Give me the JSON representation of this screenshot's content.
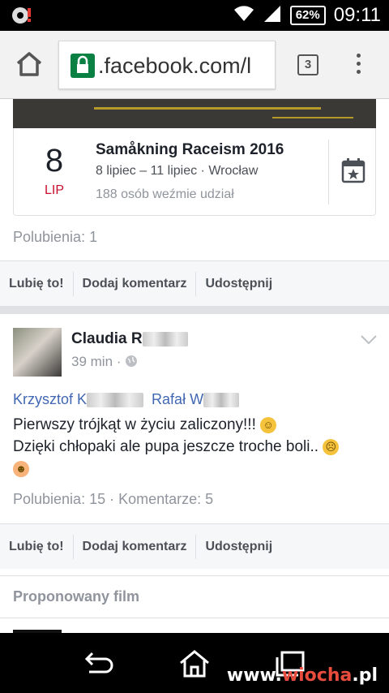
{
  "status_bar": {
    "battery": "62%",
    "time": "09:11",
    "icons": [
      "notification-icon",
      "wifi-icon",
      "signal-icon",
      "battery-icon"
    ]
  },
  "browser": {
    "url": ".facebook.com/l",
    "tab_count": "3"
  },
  "event": {
    "day": "8",
    "month": "LIP",
    "title": "Samåkning Raceism 2016",
    "details": "8 lipiec – 11 lipiec · Wrocław",
    "going": "188 osób weźmie udział"
  },
  "event_post": {
    "likes": "Polubienia: 1"
  },
  "actions": {
    "like": "Lubię to!",
    "comment": "Dodaj komentarz",
    "share": "Udostępnij"
  },
  "post": {
    "author": "Claudia R",
    "time": "39 min",
    "tags": [
      "Krzysztof K",
      "Rafał W"
    ],
    "line1": "Pierwszy trójkąt w życiu zaliczony!!!",
    "line2": "Dzięki chłopaki ale pupa jeszcze troche boli..",
    "stats": "Polubienia: 15 · Komentarze: 5"
  },
  "suggested": {
    "title": "Proponowany film"
  },
  "watermark": {
    "prefix": "www.",
    "accent": "wiocha",
    "suffix": ".pl"
  },
  "colors": {
    "link": "#4267b2",
    "secure": "#0b8043",
    "date_red": "#c8102e"
  }
}
